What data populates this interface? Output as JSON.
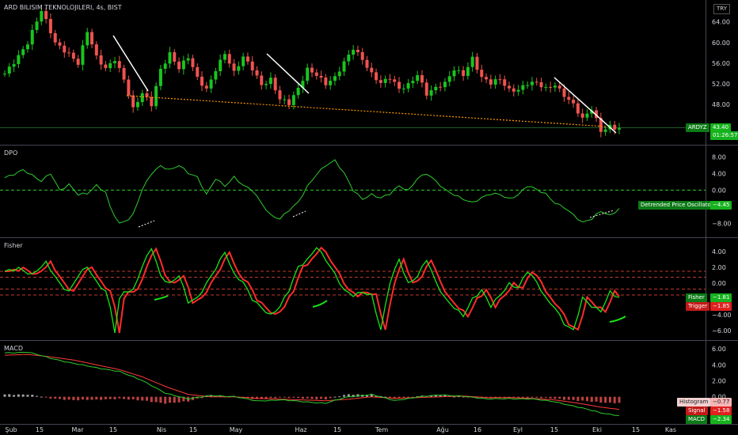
{
  "header": {
    "symbol_title": "ARD BILISIM TEKNOLOJILERI, 4s, BIST",
    "currency": "TRY"
  },
  "colors": {
    "up": "#26a69a",
    "up_bright": "#19c51e",
    "down": "#ef5350",
    "trend": "#ffffff",
    "support": "#ff9800",
    "dpo": "#2ecc2e",
    "fisher": "#17e517",
    "trigger": "#ff2b2b",
    "macd": "#2ecc2e",
    "signal": "#ff3b3b",
    "hist": "#cccccc"
  },
  "time_axis": [
    "Şub",
    "15",
    "Mar",
    "15",
    "Nis",
    "15",
    "May",
    "Haz",
    "15",
    "Tem",
    "Ağu",
    "16",
    "Eyl",
    "15",
    "Eki",
    "15",
    "Kas"
  ],
  "price_panel": {
    "ticks": [
      "64.00",
      "60.00",
      "56.00",
      "52.00",
      "48.00"
    ],
    "ticker_badge": "ARDYZ",
    "price_badge": "43.40",
    "countdown": "01:26:57"
  },
  "dpo_panel": {
    "title": "DPO",
    "ticks": [
      "8.00",
      "4.00",
      "0.00",
      "−8.00"
    ],
    "label": "Detrended Price Oscillator",
    "value": "−4.45"
  },
  "fisher_panel": {
    "title": "Fisher",
    "ticks": [
      "4.00",
      "2.00",
      "0.00",
      "−2.00",
      "−4.00",
      "−6.00"
    ],
    "fisher_label": "Fisher",
    "fisher_value": "−1.81",
    "trigger_label": "Trigger",
    "trigger_value": "−1.85"
  },
  "macd_panel": {
    "title": "MACD",
    "ticks": [
      "6.00",
      "4.00",
      "2.00",
      "0.00"
    ],
    "histogram_label": "Histogram",
    "histogram_value": "−0.77",
    "signal_label": "Signal",
    "signal_value": "−1.58",
    "macd_label": "MACD",
    "macd_value": "−2.34"
  },
  "chart_data": [
    {
      "type": "candlestick",
      "title": "ARD BILISIM TEKNOLOJILERI, 4s, BIST",
      "ylim": [
        41,
        67
      ],
      "anchors": [
        [
          0,
          54
        ],
        [
          5,
          60
        ],
        [
          8,
          66
        ],
        [
          11,
          60
        ],
        [
          14,
          58
        ],
        [
          16,
          56
        ],
        [
          18,
          62
        ],
        [
          20,
          57
        ],
        [
          22,
          55
        ],
        [
          24,
          57
        ],
        [
          26,
          53
        ],
        [
          28,
          47
        ],
        [
          30,
          50
        ],
        [
          32,
          48
        ],
        [
          34,
          55
        ],
        [
          36,
          58
        ],
        [
          38,
          55
        ],
        [
          40,
          57
        ],
        [
          42,
          53
        ],
        [
          44,
          51
        ],
        [
          46,
          55
        ],
        [
          48,
          58
        ],
        [
          50,
          54
        ],
        [
          52,
          57
        ],
        [
          54,
          55
        ],
        [
          56,
          52
        ],
        [
          58,
          53
        ],
        [
          60,
          49
        ],
        [
          62,
          48
        ],
        [
          64,
          51
        ],
        [
          66,
          55
        ],
        [
          68,
          54
        ],
        [
          70,
          52
        ],
        [
          72,
          53
        ],
        [
          74,
          56
        ],
        [
          76,
          59
        ],
        [
          78,
          57
        ],
        [
          80,
          54
        ],
        [
          82,
          52
        ],
        [
          84,
          53
        ],
        [
          86,
          51
        ],
        [
          88,
          52
        ],
        [
          90,
          54
        ],
        [
          92,
          50
        ],
        [
          94,
          51
        ],
        [
          96,
          52
        ],
        [
          98,
          55
        ],
        [
          100,
          54
        ],
        [
          102,
          57
        ],
        [
          104,
          53
        ],
        [
          106,
          52
        ],
        [
          108,
          53
        ],
        [
          110,
          51
        ],
        [
          112,
          51
        ],
        [
          114,
          52
        ],
        [
          116,
          52
        ],
        [
          118,
          51
        ],
        [
          120,
          52
        ],
        [
          122,
          50
        ],
        [
          124,
          48
        ],
        [
          126,
          45
        ],
        [
          128,
          47
        ],
        [
          130,
          43
        ],
        [
          132,
          44
        ],
        [
          134,
          43.4
        ]
      ],
      "annotations": [
        "descending trendlines",
        "dotted support line"
      ]
    },
    {
      "type": "line",
      "title": "DPO",
      "ylim": [
        -11,
        10
      ],
      "anchors": [
        [
          0,
          3
        ],
        [
          4,
          5
        ],
        [
          8,
          2
        ],
        [
          10,
          4
        ],
        [
          12,
          0
        ],
        [
          14,
          1.5
        ],
        [
          16,
          -1
        ],
        [
          18,
          -1
        ],
        [
          20,
          1
        ],
        [
          22,
          -0.5
        ],
        [
          23,
          -4
        ],
        [
          25,
          -8
        ],
        [
          27,
          -7
        ],
        [
          28,
          -6
        ],
        [
          30,
          0
        ],
        [
          32,
          4
        ],
        [
          34,
          6
        ],
        [
          36,
          5
        ],
        [
          38,
          6
        ],
        [
          40,
          4
        ],
        [
          42,
          3
        ],
        [
          44,
          -1
        ],
        [
          46,
          3
        ],
        [
          48,
          1
        ],
        [
          50,
          3
        ],
        [
          52,
          1
        ],
        [
          54,
          0
        ],
        [
          56,
          -3
        ],
        [
          58,
          -6
        ],
        [
          60,
          -7
        ],
        [
          62,
          -5
        ],
        [
          64,
          -3
        ],
        [
          66,
          1
        ],
        [
          68,
          4
        ],
        [
          70,
          6
        ],
        [
          72,
          7
        ],
        [
          74,
          4
        ],
        [
          76,
          0
        ],
        [
          78,
          -2
        ],
        [
          80,
          -1
        ],
        [
          82,
          -2
        ],
        [
          84,
          -1
        ],
        [
          86,
          1
        ],
        [
          88,
          0
        ],
        [
          90,
          3
        ],
        [
          92,
          4
        ],
        [
          94,
          2
        ],
        [
          96,
          0
        ],
        [
          98,
          -1
        ],
        [
          100,
          -2
        ],
        [
          102,
          -3
        ],
        [
          104,
          -2
        ],
        [
          106,
          -1
        ],
        [
          108,
          -1
        ],
        [
          110,
          -2
        ],
        [
          112,
          -1
        ],
        [
          114,
          1
        ],
        [
          116,
          0
        ],
        [
          118,
          -1
        ],
        [
          120,
          -3
        ],
        [
          122,
          -4
        ],
        [
          124,
          -6
        ],
        [
          126,
          -8
        ],
        [
          128,
          -7
        ],
        [
          130,
          -5
        ],
        [
          132,
          -6
        ],
        [
          134,
          -4.45
        ]
      ]
    },
    {
      "type": "line",
      "title": "Fisher",
      "ylim": [
        -7,
        5.2
      ],
      "series": [
        {
          "name": "Fisher"
        },
        {
          "name": "Trigger"
        }
      ],
      "levels": [
        1.5,
        0.75,
        -0.75,
        -1.5
      ],
      "anchors": [
        [
          0,
          1.5
        ],
        [
          3,
          2
        ],
        [
          6,
          1
        ],
        [
          9,
          2.5
        ],
        [
          12,
          0
        ],
        [
          14,
          -1
        ],
        [
          16,
          1
        ],
        [
          18,
          2
        ],
        [
          20,
          0
        ],
        [
          22,
          -1
        ],
        [
          23,
          -3
        ],
        [
          24,
          -6
        ],
        [
          25,
          -2
        ],
        [
          26,
          -1
        ],
        [
          28,
          -1
        ],
        [
          30,
          2
        ],
        [
          32,
          4.5
        ],
        [
          34,
          1
        ],
        [
          36,
          0
        ],
        [
          38,
          1
        ],
        [
          40,
          -2.5
        ],
        [
          42,
          -2
        ],
        [
          44,
          0
        ],
        [
          46,
          2
        ],
        [
          48,
          4
        ],
        [
          50,
          1
        ],
        [
          52,
          0
        ],
        [
          54,
          -2
        ],
        [
          56,
          -3
        ],
        [
          58,
          -4
        ],
        [
          60,
          -3
        ],
        [
          62,
          -1
        ],
        [
          64,
          2
        ],
        [
          66,
          3
        ],
        [
          68,
          4.7
        ],
        [
          70,
          3
        ],
        [
          72,
          1
        ],
        [
          74,
          -1
        ],
        [
          76,
          -1.5
        ],
        [
          78,
          -1
        ],
        [
          80,
          -1.5
        ],
        [
          82,
          -6
        ],
        [
          84,
          0
        ],
        [
          86,
          3
        ],
        [
          88,
          0
        ],
        [
          90,
          1
        ],
        [
          92,
          3
        ],
        [
          94,
          0
        ],
        [
          96,
          -2
        ],
        [
          98,
          -3
        ],
        [
          100,
          -4
        ],
        [
          102,
          -2
        ],
        [
          104,
          -1
        ],
        [
          106,
          -3
        ],
        [
          108,
          -1.5
        ],
        [
          110,
          0
        ],
        [
          112,
          -0.5
        ],
        [
          114,
          1.5
        ],
        [
          116,
          0
        ],
        [
          118,
          -2
        ],
        [
          120,
          -3
        ],
        [
          122,
          -5
        ],
        [
          124,
          -6
        ],
        [
          126,
          -2
        ],
        [
          128,
          -3
        ],
        [
          130,
          -3.5
        ],
        [
          132,
          -1
        ],
        [
          134,
          -1.81
        ]
      ]
    },
    {
      "type": "line",
      "title": "MACD",
      "ylim": [
        -3.2,
        6.5
      ],
      "series": [
        {
          "name": "MACD"
        },
        {
          "name": "Signal"
        },
        {
          "name": "Histogram"
        }
      ],
      "macd_anchors": [
        [
          0,
          5.5
        ],
        [
          5,
          5.6
        ],
        [
          10,
          4.8
        ],
        [
          15,
          4.2
        ],
        [
          20,
          3.6
        ],
        [
          25,
          3.2
        ],
        [
          30,
          2
        ],
        [
          35,
          0.5
        ],
        [
          40,
          -0.3
        ],
        [
          45,
          0.2
        ],
        [
          50,
          0
        ],
        [
          55,
          -0.5
        ],
        [
          60,
          -0.4
        ],
        [
          65,
          -0.6
        ],
        [
          70,
          -0.8
        ],
        [
          75,
          0
        ],
        [
          80,
          0.3
        ],
        [
          85,
          -0.5
        ],
        [
          90,
          0
        ],
        [
          95,
          0.2
        ],
        [
          100,
          0.1
        ],
        [
          105,
          -0.3
        ],
        [
          110,
          -0.2
        ],
        [
          115,
          -0.3
        ],
        [
          120,
          -0.6
        ],
        [
          125,
          -1.3
        ],
        [
          130,
          -2
        ],
        [
          134,
          -2.34
        ]
      ],
      "signal_anchors": [
        [
          0,
          5.2
        ],
        [
          5,
          5.3
        ],
        [
          10,
          5
        ],
        [
          15,
          4.6
        ],
        [
          20,
          4
        ],
        [
          25,
          3.4
        ],
        [
          30,
          2.5
        ],
        [
          35,
          1.3
        ],
        [
          40,
          0.3
        ],
        [
          45,
          0
        ],
        [
          50,
          0
        ],
        [
          55,
          -0.2
        ],
        [
          60,
          -0.3
        ],
        [
          65,
          -0.4
        ],
        [
          70,
          -0.5
        ],
        [
          75,
          -0.3
        ],
        [
          80,
          0
        ],
        [
          85,
          -0.2
        ],
        [
          90,
          -0.1
        ],
        [
          95,
          0
        ],
        [
          100,
          0.1
        ],
        [
          105,
          -0.1
        ],
        [
          110,
          -0.1
        ],
        [
          115,
          -0.2
        ],
        [
          120,
          -0.4
        ],
        [
          125,
          -0.8
        ],
        [
          130,
          -1.3
        ],
        [
          134,
          -1.58
        ]
      ]
    }
  ]
}
